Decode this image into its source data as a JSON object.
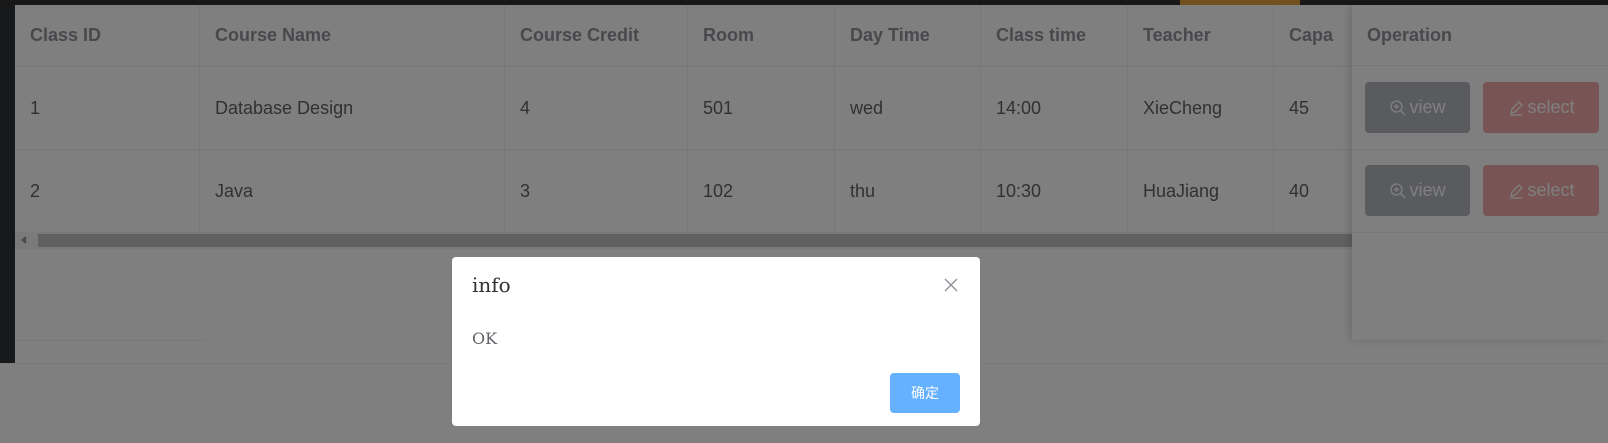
{
  "table": {
    "columns": [
      {
        "label": "Class ID"
      },
      {
        "label": "Course Name"
      },
      {
        "label": "Course Credit"
      },
      {
        "label": "Room"
      },
      {
        "label": "Day Time"
      },
      {
        "label": "Class time"
      },
      {
        "label": "Teacher"
      },
      {
        "label": "Capa"
      }
    ],
    "rows": [
      {
        "cells": [
          "1",
          "Database Design",
          "4",
          "501",
          "wed",
          "14:00",
          "XieCheng",
          "45"
        ]
      },
      {
        "cells": [
          "2",
          "Java",
          "3",
          "102",
          "thu",
          "10:30",
          "HuaJiang",
          "40"
        ]
      }
    ],
    "operation_header": "Operation",
    "view_label": "view",
    "select_label": "select"
  },
  "dialog": {
    "title": "info",
    "message": "OK",
    "confirm_label": "确定"
  },
  "icons": {
    "view": "zoom-in-icon",
    "select": "edit-pencil-icon",
    "close": "close-icon"
  },
  "colors": {
    "confirm_button": "#66b1ff",
    "view_button": "#909399",
    "select_button": "#f56c6c",
    "sidebar": "#2f3338"
  }
}
